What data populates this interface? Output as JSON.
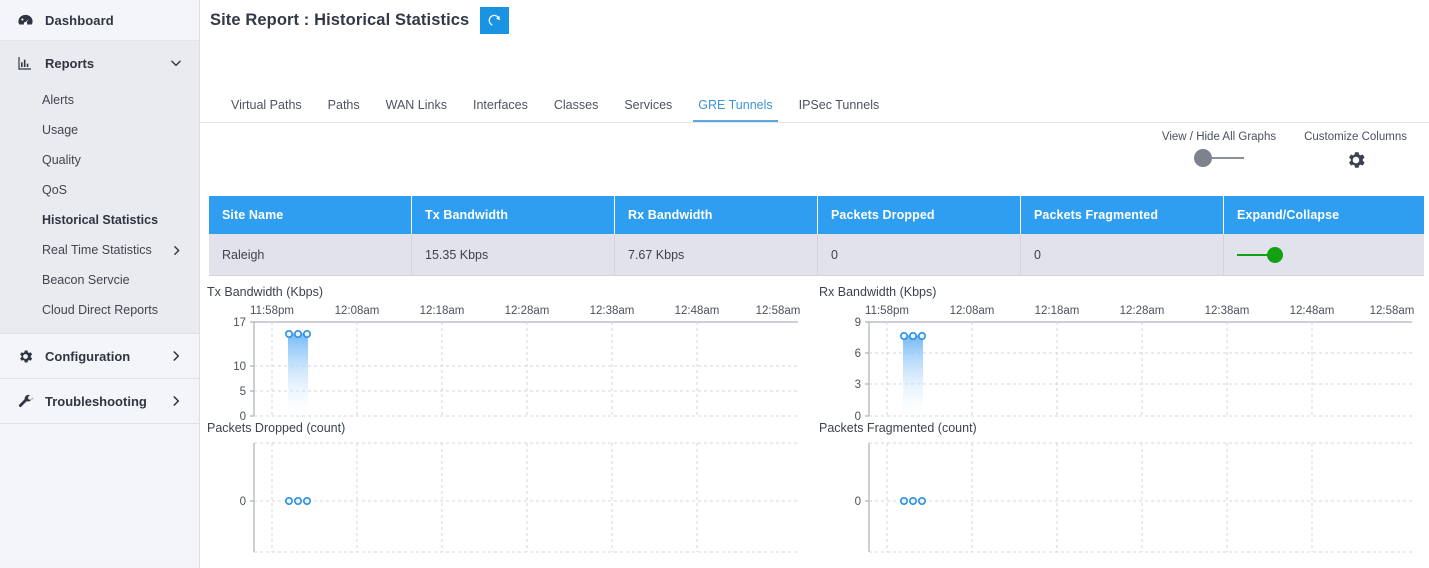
{
  "sidebar": {
    "dashboard": {
      "label": "Dashboard",
      "icon": "gauge-icon"
    },
    "reports": {
      "label": "Reports",
      "icon": "bar-chart-icon",
      "chevron": "chevron-down-icon"
    },
    "report_items": [
      {
        "label": "Alerts",
        "active": false,
        "chevron": ""
      },
      {
        "label": "Usage",
        "active": false,
        "chevron": ""
      },
      {
        "label": "Quality",
        "active": false,
        "chevron": ""
      },
      {
        "label": "QoS",
        "active": false,
        "chevron": ""
      },
      {
        "label": "Historical Statistics",
        "active": true,
        "chevron": ""
      },
      {
        "label": "Real Time Statistics",
        "active": false,
        "chevron": "chevron-right-icon"
      },
      {
        "label": "Beacon Servcie",
        "active": false,
        "chevron": ""
      },
      {
        "label": "Cloud Direct Reports",
        "active": false,
        "chevron": ""
      }
    ],
    "configuration": {
      "label": "Configuration",
      "icon": "gear-icon",
      "chevron": "chevron-right-icon"
    },
    "troubleshooting": {
      "label": "Troubleshooting",
      "icon": "wrench-icon",
      "chevron": "chevron-right-icon"
    }
  },
  "header": {
    "title": "Site Report : Historical Statistics",
    "refresh_icon": "refresh-icon"
  },
  "tabs": [
    {
      "label": "Virtual Paths",
      "active": false
    },
    {
      "label": "Paths",
      "active": false
    },
    {
      "label": "WAN Links",
      "active": false
    },
    {
      "label": "Interfaces",
      "active": false
    },
    {
      "label": "Classes",
      "active": false
    },
    {
      "label": "Services",
      "active": false
    },
    {
      "label": "GRE Tunnels",
      "active": true
    },
    {
      "label": "IPSec Tunnels",
      "active": false
    }
  ],
  "toolbar": {
    "view_hide_label": "View / Hide All Graphs",
    "view_hide_state": "off",
    "customize_columns_label": "Customize Columns",
    "gear_icon": "gear-icon"
  },
  "table": {
    "columns": [
      "Site Name",
      "Tx Bandwidth",
      "Rx Bandwidth",
      "Packets Dropped",
      "Packets Fragmented",
      "Expand/Collapse"
    ],
    "rows": [
      {
        "site_name": "Raleigh",
        "tx_bandwidth": "15.35 Kbps",
        "rx_bandwidth": "7.67 Kbps",
        "packets_dropped": "0",
        "packets_fragmented": "0",
        "expand_state": "on"
      }
    ],
    "header_color": "#2f9ef0",
    "row_color": "#e2e2ec",
    "toggle_on_color": "#12a112"
  },
  "chart_data": [
    {
      "type": "area",
      "title": "Tx Bandwidth (Kbps)",
      "xlabel": "",
      "ylabel": "Kbps",
      "yticks": [
        0,
        5,
        10,
        17
      ],
      "ylim": [
        0,
        17
      ],
      "xticks": [
        "11:58pm",
        "12:08am",
        "12:18am",
        "12:28am",
        "12:38am",
        "12:48am",
        "12:58am"
      ],
      "x": [
        "11:58pm",
        "11:59pm",
        "12:00am"
      ],
      "values": [
        15.35,
        15.35,
        15.35
      ],
      "grid": true,
      "legend": "none",
      "series_color": "#5ab0f2"
    },
    {
      "type": "area",
      "title": "Rx Bandwidth (Kbps)",
      "xlabel": "",
      "ylabel": "Kbps",
      "yticks": [
        0,
        3,
        6,
        9
      ],
      "ylim": [
        0,
        9
      ],
      "xticks": [
        "11:58pm",
        "12:08am",
        "12:18am",
        "12:28am",
        "12:38am",
        "12:48am",
        "12:58am"
      ],
      "x": [
        "11:58pm",
        "11:59pm",
        "12:00am"
      ],
      "values": [
        7.67,
        7.67,
        7.67
      ],
      "grid": true,
      "legend": "none",
      "series_color": "#5ab0f2"
    },
    {
      "type": "area",
      "title": "Packets Dropped (count)",
      "xlabel": "",
      "ylabel": "count",
      "yticks": [
        0
      ],
      "ylim": [
        0,
        0
      ],
      "xticks": [],
      "x": [
        "11:58pm",
        "11:59pm",
        "12:00am"
      ],
      "values": [
        0,
        0,
        0
      ],
      "grid": true,
      "legend": "none",
      "series_color": "#5ab0f2"
    },
    {
      "type": "area",
      "title": "Packets Fragmented (count)",
      "xlabel": "",
      "ylabel": "count",
      "yticks": [
        0
      ],
      "ylim": [
        0,
        0
      ],
      "xticks": [],
      "x": [
        "11:58pm",
        "11:59pm",
        "12:00am"
      ],
      "values": [
        0,
        0,
        0
      ],
      "grid": true,
      "legend": "none",
      "series_color": "#5ab0f2"
    }
  ]
}
